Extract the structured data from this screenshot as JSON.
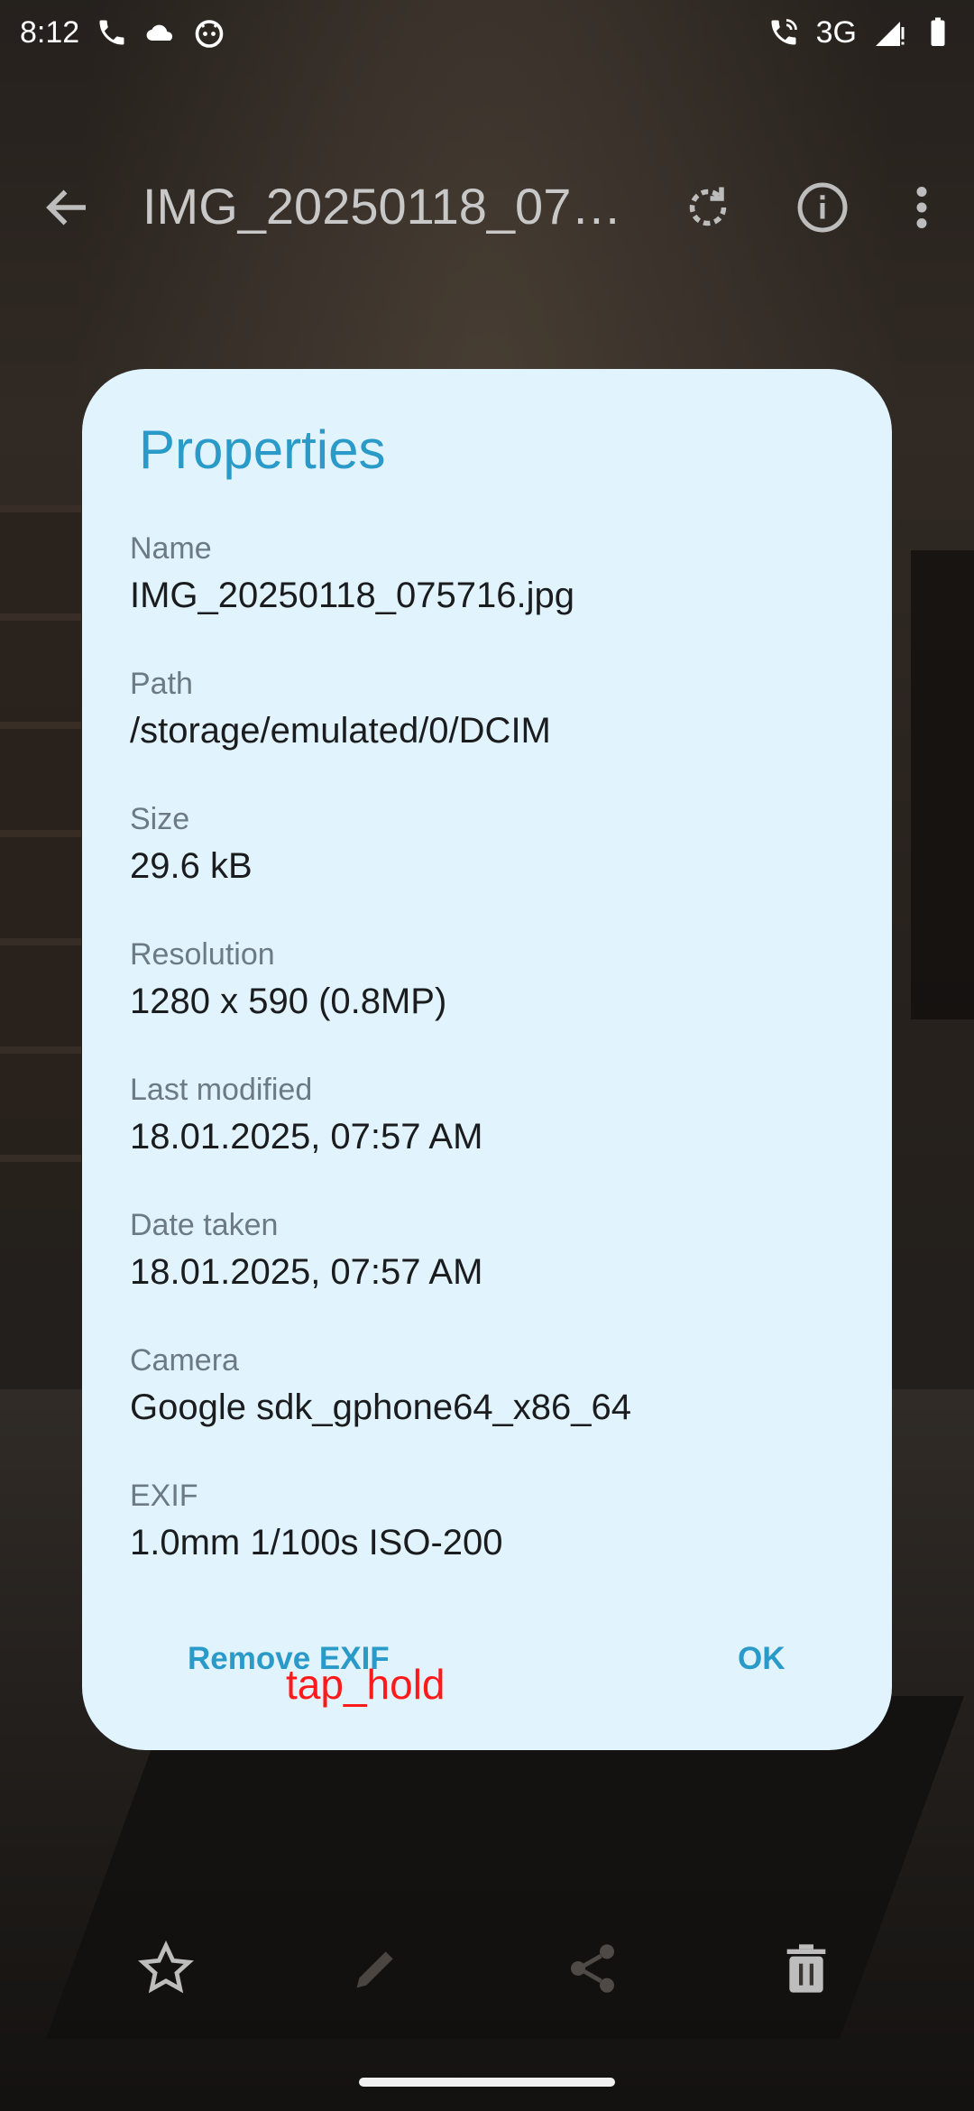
{
  "status_bar": {
    "time": "8:12",
    "network": "3G"
  },
  "app_bar": {
    "title": "IMG_20250118_07…"
  },
  "dialog": {
    "title": "Properties",
    "properties": [
      {
        "label": "Name",
        "value": "IMG_20250118_075716.jpg"
      },
      {
        "label": "Path",
        "value": "/storage/emulated/0/DCIM"
      },
      {
        "label": "Size",
        "value": "29.6 kB"
      },
      {
        "label": "Resolution",
        "value": "1280 x 590 (0.8MP)"
      },
      {
        "label": "Last modified",
        "value": "18.01.2025, 07:57 AM"
      },
      {
        "label": "Date taken",
        "value": "18.01.2025, 07:57 AM"
      },
      {
        "label": "Camera",
        "value": "Google sdk_gphone64_x86_64"
      },
      {
        "label": "EXIF",
        "value": "1.0mm  1/100s  ISO-200"
      }
    ],
    "remove_exif_label": "Remove EXIF",
    "ok_label": "OK"
  },
  "overlay": {
    "text": "tap_hold"
  },
  "colors": {
    "accent": "#2a9ac9",
    "dialog_bg": "#e1f3fd",
    "overlay_text": "#ff1a1a"
  },
  "icons": {
    "status_left": [
      "phone-icon",
      "cloud-icon",
      "android-face-icon"
    ],
    "status_right": [
      "wifi-calling-icon",
      "signal-icon",
      "battery-icon"
    ],
    "app_bar": [
      "back-arrow-icon",
      "rotate-icon",
      "info-icon",
      "more-vert-icon"
    ],
    "bottom_bar": [
      "star-icon",
      "edit-icon",
      "share-icon",
      "delete-icon"
    ]
  }
}
